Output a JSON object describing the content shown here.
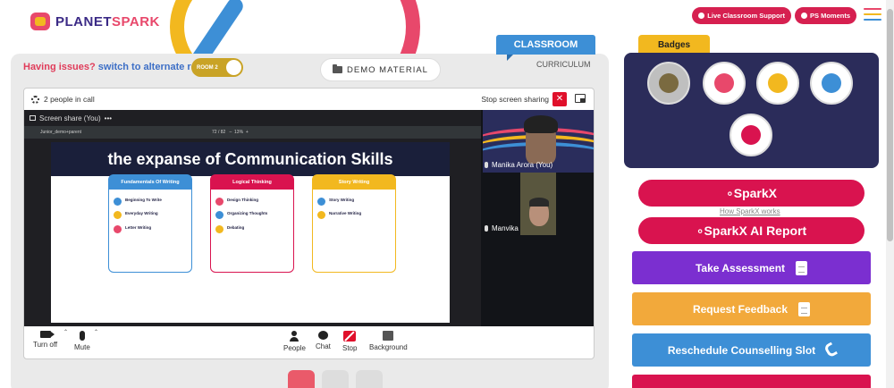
{
  "brand": {
    "logo_text_1": "PLANET",
    "logo_text_2": "SPARK"
  },
  "header": {
    "live_support": "Live Classroom Support",
    "ps_moments": "PS Moments",
    "menu_colors": [
      "#e8486b",
      "#f2b81f",
      "#3d8fd6"
    ]
  },
  "tabs": {
    "classroom": "CLASSROOM",
    "curriculum": "CURRICULUM"
  },
  "issues": {
    "question": "Having issues?",
    "link": "switch to alternate room",
    "room_label": "ROOM 2"
  },
  "demo_material": "DEMO MATERIAL",
  "call": {
    "people_count": "2 people in call",
    "stop_sharing": "Stop screen sharing",
    "screen_share_label": "Screen share (You)",
    "menu_dots": "•••",
    "pdf_filename": "Junior_demo+parent",
    "pdf_page": "72 / 82",
    "pdf_zoom": "13%",
    "slide_title": "the expanse of Communication Skills",
    "cards": [
      {
        "title": "Fundamentals Of Writing",
        "color": "#3d8fd6",
        "items": [
          "Beginning To Write",
          "Everyday Writing",
          "Letter Writing"
        ]
      },
      {
        "title": "Logical Thinking",
        "color": "#d9134f",
        "items": [
          "Design Thinking",
          "Organizing Thoughts",
          "Debating"
        ]
      },
      {
        "title": "Story Writing",
        "color": "#f2b81f",
        "items": [
          "Story Writing",
          "Narrative Writing"
        ]
      }
    ],
    "participants": [
      "Manika Arora (You)",
      "Manvika"
    ],
    "controls": {
      "turn_off": "Turn off",
      "mute": "Mute",
      "people": "People",
      "chat": "Chat",
      "stop": "Stop",
      "background": "Background"
    }
  },
  "badges": {
    "title": "Badges"
  },
  "sparkx": {
    "label": "∘SparkX",
    "how_link": "How SparkX works",
    "report": "∘SparkX AI Report"
  },
  "actions": [
    {
      "label": "Take Assessment",
      "color": "#7b2fd0"
    },
    {
      "label": "Request Feedback",
      "color": "#f2a93b"
    },
    {
      "label": "Reschedule Counselling Slot",
      "color": "#3d8fd6"
    }
  ],
  "colors": {
    "brand_red": "#d9134f",
    "classroom_blue": "#3d8fd6",
    "badges_navy": "#2b2c5a"
  }
}
